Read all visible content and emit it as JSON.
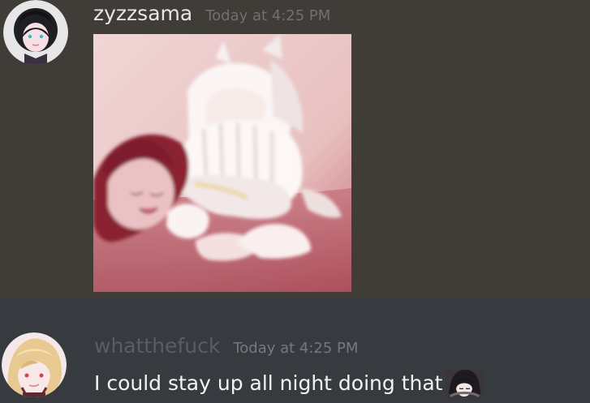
{
  "messages": [
    {
      "username": "zyzzsama",
      "timestamp": "Today at 4:25 PM",
      "avatar_icon": "avatar-icon",
      "attachment_icon": "image-attachment-icon"
    },
    {
      "username": "whatthefuck",
      "timestamp": "Today at 4:25 PM",
      "text": "I could stay up all night doing that",
      "avatar_icon": "avatar-icon",
      "emoji_icon": "custom-emoji-icon"
    }
  ],
  "colors": {
    "message_1_bg": "#403d38",
    "message_2_bg": "#373b40",
    "username_1": "#e6e6e6",
    "username_2": "#5a5d62",
    "timestamp": "#6e7074",
    "message_text": "#f3f3f3"
  }
}
